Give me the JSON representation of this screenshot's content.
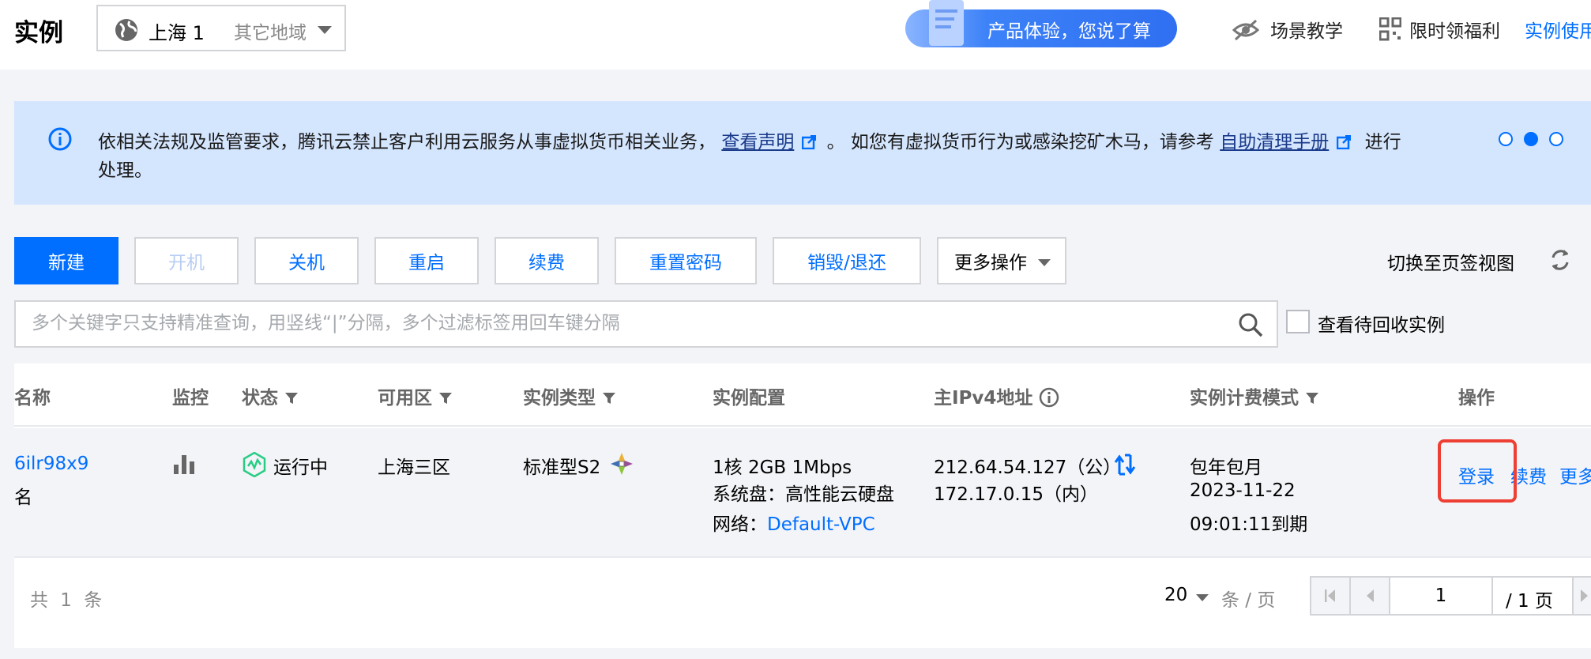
{
  "header": {
    "title": "实例",
    "region": {
      "current": "上海 1",
      "other": "其它地域"
    },
    "feedback": "产品体验，您说了算",
    "links": {
      "scene_tour": "场景教学",
      "welfare": "限时领福利",
      "usage": "实例使用"
    }
  },
  "banner": {
    "text_part1": "依相关法规及监管要求，腾讯云禁止客户利用云服务从事虚拟货币相关业务，",
    "link1": "查看声明",
    "text_part2": "。 如您有虚拟货币行为或感染挖矿木马，请参考",
    "link2": "自助清理手册",
    "text_part3": "进行",
    "text_line2": "处理。",
    "active_dot": 1
  },
  "toolbar": {
    "new": "新建",
    "start": "开机",
    "shutdown": "关机",
    "restart": "重启",
    "renew": "续费",
    "reset_password": "重置密码",
    "destroy": "销毁/退还",
    "more": "更多操作",
    "tab_view": "切换至页签视图"
  },
  "search": {
    "placeholder": "多个关键字只支持精准查询，用竖线“|”分隔，多个过滤标签用回车键分隔",
    "value": "",
    "recycle_label": "查看待回收实例"
  },
  "table": {
    "columns": {
      "name": "名称",
      "monitor": "监控",
      "status": "状态",
      "zone": "可用区",
      "type": "实例类型",
      "config": "实例配置",
      "ip": "主IPv4地址",
      "billing": "实例计费模式",
      "actions": "操作"
    },
    "rows": [
      {
        "id": "6ilr98x9",
        "name": "名",
        "status": "运行中",
        "zone": "上海三区",
        "type": "标准型S2",
        "config_line1": "1核 2GB 1Mbps",
        "config_line2": "系统盘：高性能云硬盘",
        "config_line3_label": "网络：",
        "config_line3_link": "Default-VPC",
        "ip_public": "212.64.54.127（公）",
        "ip_private": "172.17.0.15（内）",
        "billing_mode": "包年包月",
        "billing_date": "2023-11-22",
        "billing_expire": "09:01:11到期",
        "action_login": "登录",
        "action_renew": "续费",
        "action_more": "更多"
      }
    ]
  },
  "footer": {
    "total": "共 1 条",
    "page_size": "20",
    "per_page": "条 / 页",
    "current_page": "1",
    "total_pages": "/ 1 页"
  },
  "colors": {
    "primary": "#006eff",
    "banner_bg": "#d4e5fe",
    "highlight": "#ee3f35",
    "running": "#29cc85"
  }
}
